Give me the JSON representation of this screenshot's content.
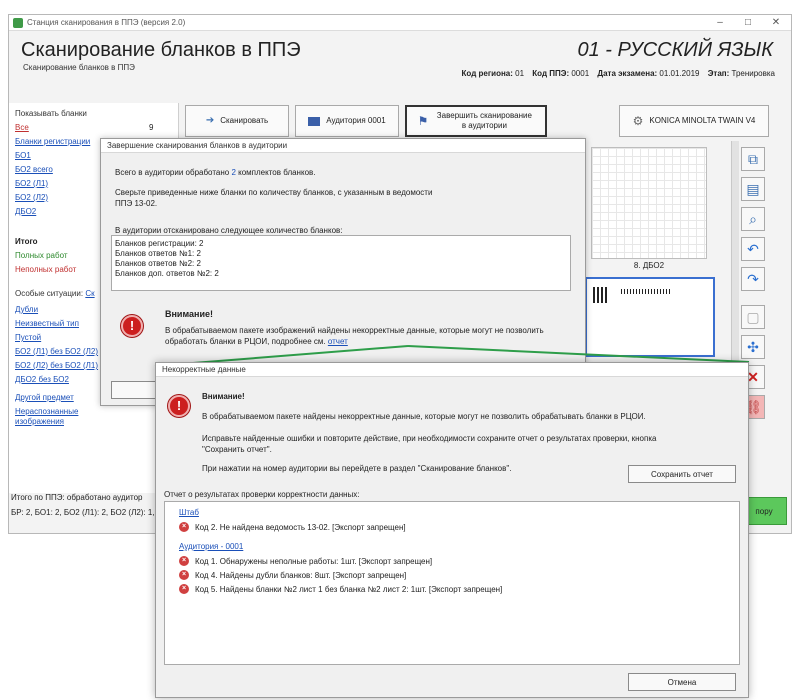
{
  "window": {
    "title": "Станция сканирования в ППЭ (версия 2.0)",
    "app_title": "Сканирование бланков в ППЭ",
    "app_subtitle": "Сканирование бланков в ППЭ",
    "subject": "01 - РУССКИЙ ЯЗЫК",
    "region_label": "Код региона:",
    "region_value": "01",
    "ppe_label": "Код ППЭ:",
    "ppe_value": "0001",
    "date_label": "Дата экзамена:",
    "date_value": "01.01.2019",
    "stage_label": "Этап:",
    "stage_value": "Тренировка"
  },
  "left_panel": {
    "header": "Показывать бланки",
    "items": [
      {
        "label": "Все",
        "count": "9"
      },
      {
        "label": "Бланки регистрации",
        "count": ""
      },
      {
        "label": "БО1",
        "count": ""
      },
      {
        "label": "БО2 всего",
        "count": ""
      },
      {
        "label": "БО2 (Л1)",
        "count": ""
      },
      {
        "label": "БО2 (Л2)",
        "count": ""
      },
      {
        "label": "ДБО2",
        "count": ""
      }
    ],
    "total_label": "Итого",
    "full_label": "Полных работ",
    "partial_label": "Неполных работ",
    "special_label": "Особые ситуации:",
    "special_link": "Ск",
    "special_items": [
      "Дубли",
      "Неизвестный тип",
      "Пустой",
      "БО2 (Л1) без БО2 (Л2)",
      "БО2 (Л2) без БО2 (Л1)",
      "ДБО2 без БО2",
      "Другой предмет",
      "Нераспознанные изображения"
    ],
    "bottom_line1": "Итого по ППЭ: обработано аудитор",
    "bottom_line2": "БР: 2, БО1: 2, БО2 (Л1): 2, БО2 (Л2): 1,"
  },
  "toolbar": {
    "scan_label": "Сканировать",
    "room_label": "Аудитория 0001",
    "finish_label": "Завершить сканирование в аудитории",
    "scanner_label": "KONICA MINOLTA TWAIN V4"
  },
  "thumb_caption": "8. ДБО2",
  "bottom_right_label": "пору",
  "dialog1": {
    "title": "Завершение сканирования бланков в аудитории",
    "processed_pre": "Всего в аудитории обработано",
    "processed_count": "2",
    "processed_post": "комплектов бланков.",
    "check_text": "Сверьте приведенные ниже бланки по количеству бланков, с указанным в ведомости ППЭ 13-02.",
    "scanned_header": "В аудитории отсканировано следующее количество бланков:",
    "counts": [
      "Бланков регистрации: 2",
      "Бланков ответов №1: 2",
      "Бланков ответов №2: 2",
      "Бланков доп. ответов №2: 2"
    ],
    "warning_title": "Внимание!",
    "warning_text": "В обрабатываемом пакете изображений найдены некорректные данные, которые могут не позволить обработать бланки в РЦОИ, подробнее см.",
    "warning_link": "отчет",
    "button_partial": "А"
  },
  "dialog2": {
    "title": "Некорректные данные",
    "warning_title": "Внимание!",
    "line1": "В обрабатываемом пакете найдены некорректные данные, которые могут не позволить обрабатывать бланки в РЦОИ.",
    "line2": "Исправьте найденные ошибки и повторите действие, при необходимости сохраните отчет о результатах проверки, кнопка \"Сохранить отчет\".",
    "line3": "При нажатии на номер аудитории вы перейдете в раздел \"Сканирование бланков\".",
    "save_button": "Сохранить отчет",
    "report_label": "Отчет о результатах проверки корректности данных:",
    "report": {
      "group1": "Штаб",
      "group1_rows": [
        "Код 2. Не найдена ведомость 13-02. [Экспорт запрещен]"
      ],
      "group2": "Аудитория - 0001",
      "group2_rows": [
        "Код 1. Обнаружены неполные работы: 1шт. [Экспорт запрещен]",
        "Код 4. Найдены дубли бланков: 8шт. [Экспорт запрещен]",
        "Код 5. Найдены бланки №2 лист 1 без бланка №2 лист 2: 1шт. [Экспорт запрещен]"
      ]
    },
    "cancel_button": "Отмена"
  },
  "colors": {
    "error_red": "#cc1f1f",
    "link_blue": "#1a4fb8",
    "connector_green": "#2e9e4a",
    "ok_green": "#5cc85c"
  }
}
